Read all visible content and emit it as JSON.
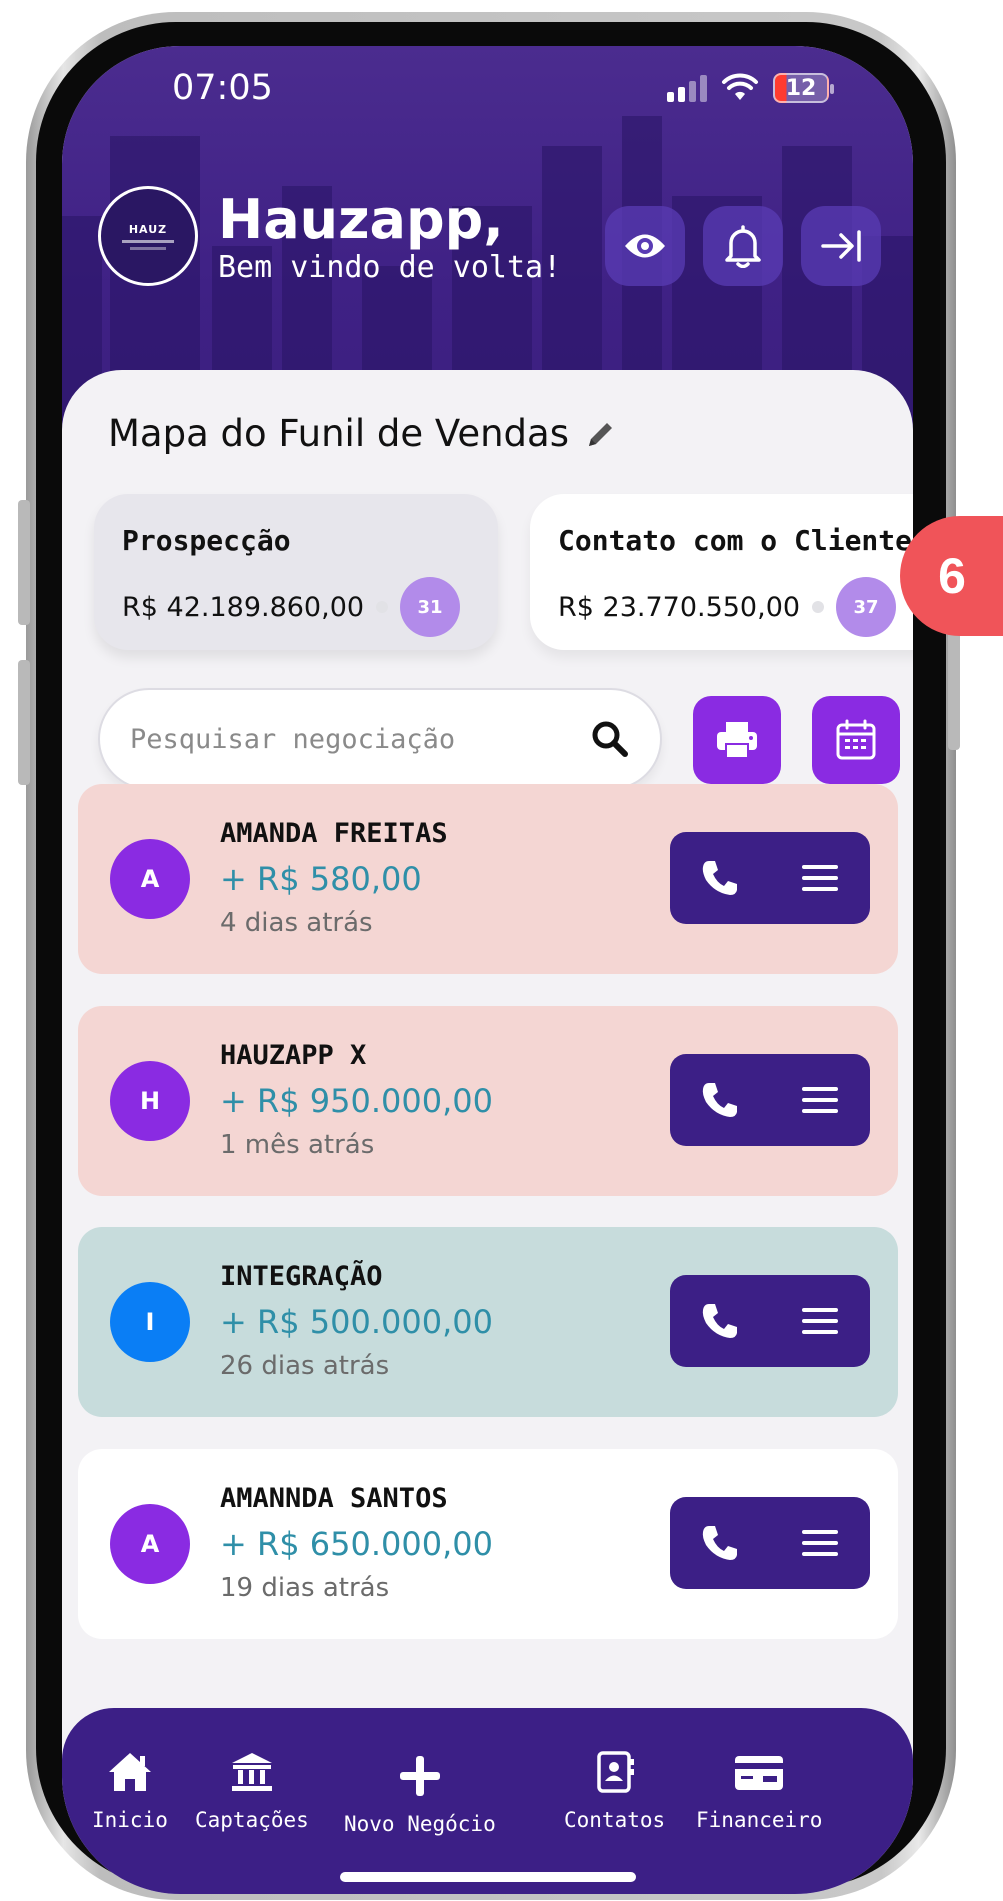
{
  "status": {
    "time": "07:05",
    "battery": "12"
  },
  "header": {
    "logo_text": "HAUZ",
    "greeting_name": "Hauzapp,",
    "greeting_sub": "Bem vindo de volta!"
  },
  "funnel": {
    "title": "Mapa do Funil de Vendas",
    "stages": [
      {
        "name": "Prospecção",
        "value": "R$ 42.189.860,00",
        "count": "31"
      },
      {
        "name": "Contato com o Cliente",
        "value": "R$ 23.770.550,00",
        "count": "37"
      }
    ]
  },
  "search": {
    "placeholder": "Pesquisar negociação"
  },
  "deals": [
    {
      "initial": "A",
      "name": "AMANDA FREITAS",
      "value": "+ R$ 580,00",
      "time": "4 dias atrás",
      "avatar_color": "#8a2be2",
      "bg": "pink"
    },
    {
      "initial": "H",
      "name": "HAUZAPP X",
      "value": "+ R$ 950.000,00",
      "time": "1 mês atrás",
      "avatar_color": "#8a2be2",
      "bg": "pink"
    },
    {
      "initial": "I",
      "name": "INTEGRAÇÃO",
      "value": "+ R$ 500.000,00",
      "time": "26 dias atrás",
      "avatar_color": "#0a7ef5",
      "bg": "teal"
    },
    {
      "initial": "A",
      "name": "AMANNDA SANTOS",
      "value": "+ R$ 650.000,00",
      "time": "19 dias atrás",
      "avatar_color": "#8a2be2",
      "bg": "white"
    }
  ],
  "nav": [
    {
      "label": "Inicio",
      "icon": "home-icon"
    },
    {
      "label": "Captações",
      "icon": "bank-icon"
    },
    {
      "label": "Novo Negócio",
      "icon": "plus-icon"
    },
    {
      "label": "Contatos",
      "icon": "contacts-icon"
    },
    {
      "label": "Financeiro",
      "icon": "card-icon"
    }
  ],
  "step_badge": "6",
  "colors": {
    "header_bg": "#3f2185",
    "accent_purple": "#8a2be2",
    "action_bg": "#3c1f86",
    "value_teal": "#2f8fa8",
    "badge_red": "#f05459"
  }
}
